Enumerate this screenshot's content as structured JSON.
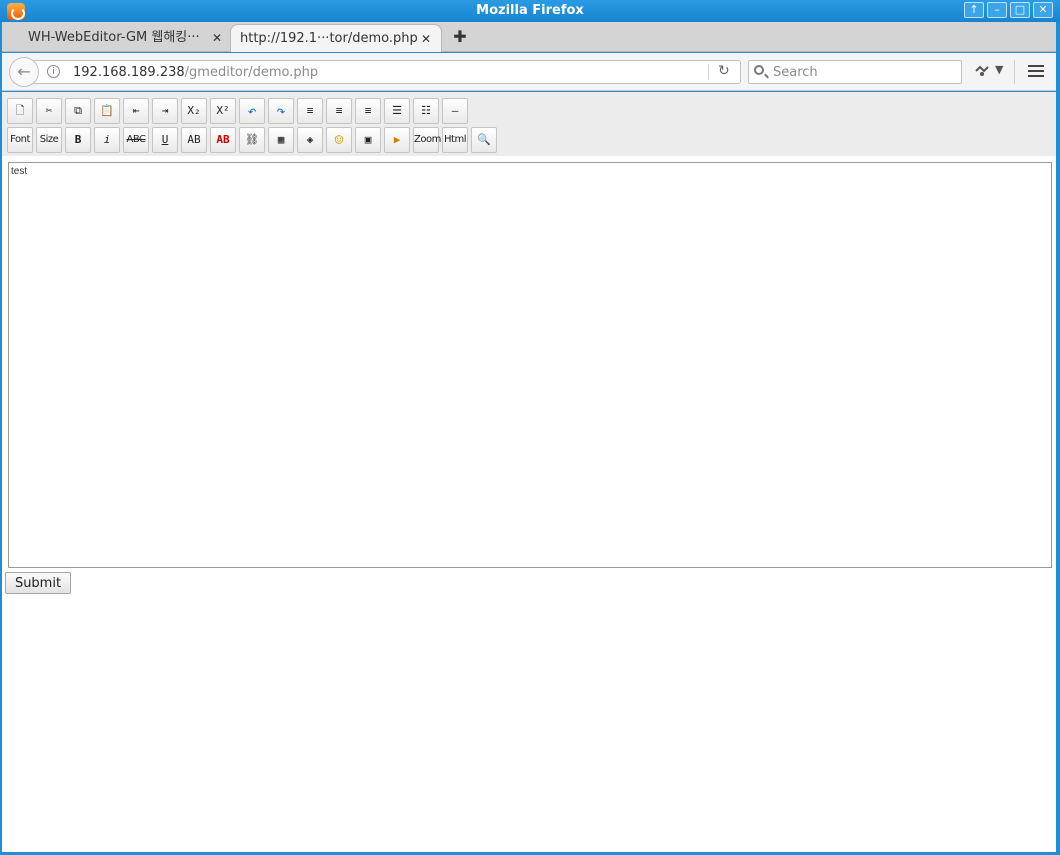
{
  "window": {
    "title": "Mozilla Firefox",
    "buttons": [
      "↑",
      "–",
      "□",
      "✕"
    ]
  },
  "tabs": [
    {
      "label": "WH-WebEditor-GM 웹해킹···",
      "close": "✕",
      "active": false
    },
    {
      "label": "http://192.1···tor/demo.php",
      "close": "✕",
      "active": true
    }
  ],
  "new_tab": "✚",
  "nav": {
    "back": "←",
    "url_host": "192.168.189.238",
    "url_path": "/gmeditor/demo.php",
    "info": "i",
    "reload": "↻",
    "search_placeholder": "Search",
    "ext_dropdown": "▼"
  },
  "toolbar": {
    "row1": [
      {
        "name": "new-doc",
        "glyph": "🗋"
      },
      {
        "name": "cut",
        "glyph": "✂"
      },
      {
        "name": "copy",
        "glyph": "⧉"
      },
      {
        "name": "paste",
        "glyph": "📋"
      },
      {
        "name": "outdent",
        "glyph": "⇤"
      },
      {
        "name": "indent",
        "glyph": "⇥"
      },
      {
        "name": "subscript",
        "glyph": "X₂"
      },
      {
        "name": "superscript",
        "glyph": "X²"
      },
      {
        "name": "undo",
        "glyph": "↶"
      },
      {
        "name": "redo",
        "glyph": "↷"
      },
      {
        "name": "align-left",
        "glyph": "≡"
      },
      {
        "name": "align-center",
        "glyph": "≡"
      },
      {
        "name": "align-right",
        "glyph": "≡"
      },
      {
        "name": "ordered-list",
        "glyph": "☰"
      },
      {
        "name": "unordered-list",
        "glyph": "☷"
      },
      {
        "name": "horizontal-rule",
        "glyph": "—"
      }
    ],
    "row2": [
      {
        "name": "font",
        "glyph": "Font"
      },
      {
        "name": "size",
        "glyph": "Size"
      },
      {
        "name": "bold",
        "glyph": "B"
      },
      {
        "name": "italic",
        "glyph": "i"
      },
      {
        "name": "strikethrough",
        "glyph": "ABC"
      },
      {
        "name": "underline",
        "glyph": "U"
      },
      {
        "name": "spellcheck",
        "glyph": "AB"
      },
      {
        "name": "spellcheck-red",
        "glyph": "AB"
      },
      {
        "name": "link",
        "glyph": "⛓"
      },
      {
        "name": "table",
        "glyph": "▦"
      },
      {
        "name": "special",
        "glyph": "◈"
      },
      {
        "name": "emoticon",
        "glyph": "☺"
      },
      {
        "name": "image",
        "glyph": "▣"
      },
      {
        "name": "media",
        "glyph": "▶"
      },
      {
        "name": "zoom",
        "glyph": "Zoom"
      },
      {
        "name": "html",
        "glyph": "Html"
      },
      {
        "name": "preview",
        "glyph": "🔍"
      }
    ]
  },
  "editor": {
    "content": "test"
  },
  "form": {
    "submit_label": "Submit"
  }
}
